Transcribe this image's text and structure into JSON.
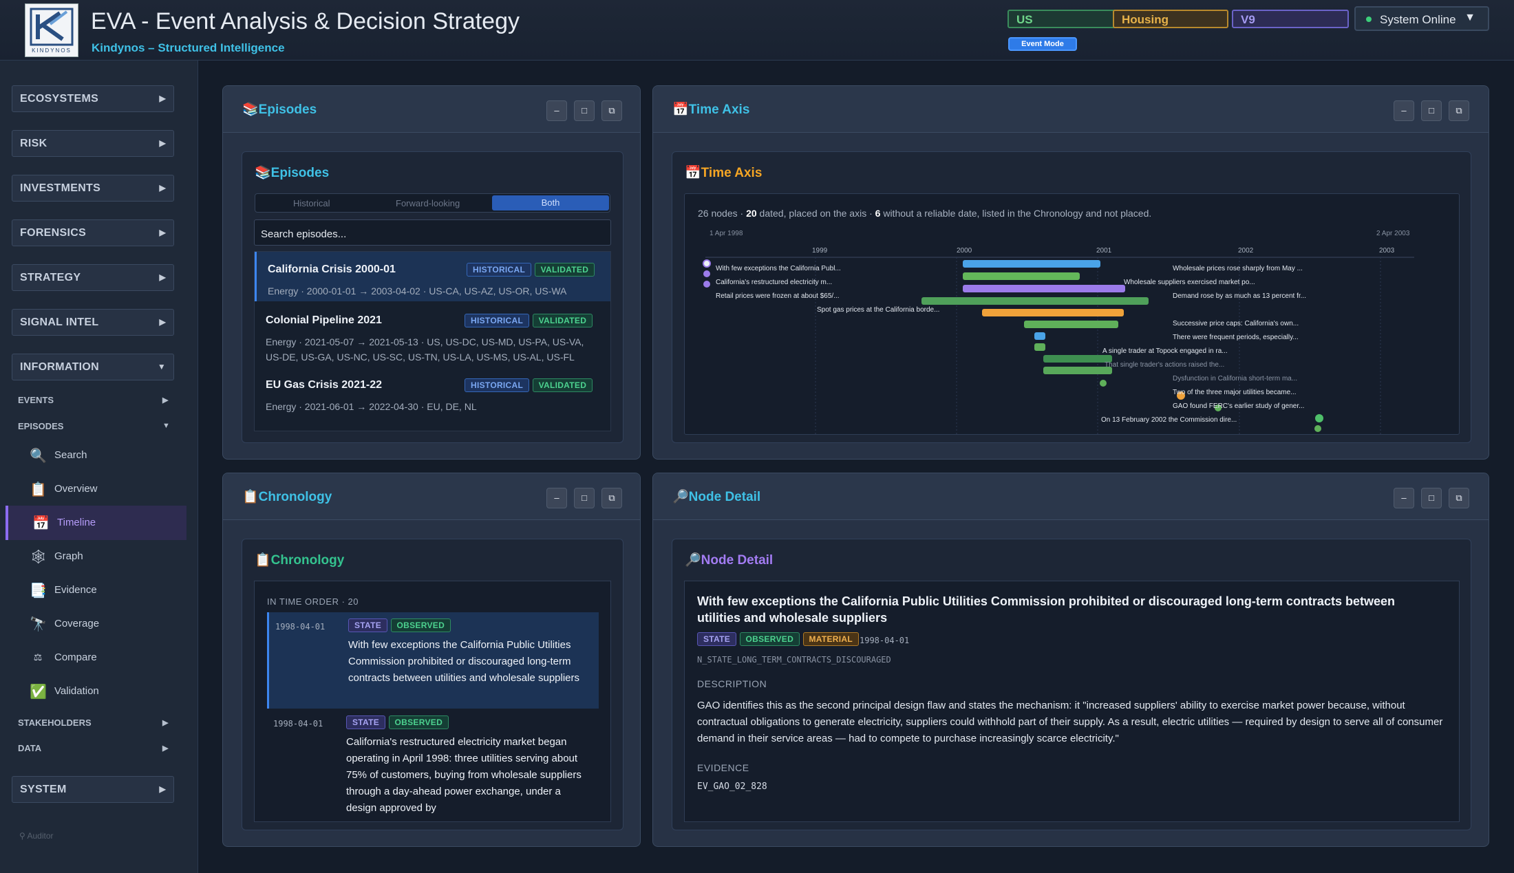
{
  "header": {
    "logo_text": "KINDYNOS",
    "title": "EVA - Event Analysis & Decision Strategy",
    "subtitle": "Kindynos – Structured Intelligence",
    "chips": [
      "US",
      "Housing",
      "V9"
    ],
    "status": "System Online",
    "mode_button": "Event Mode",
    "colors": {
      "accent": "#3fc1e6",
      "status_dot": "#3ccf7a"
    }
  },
  "sidebar": {
    "sections": [
      {
        "label": "ECOSYSTEMS"
      },
      {
        "label": "RISK"
      },
      {
        "label": "INVESTMENTS"
      },
      {
        "label": "FORENSICS"
      },
      {
        "label": "STRATEGY"
      },
      {
        "label": "SIGNAL INTEL"
      },
      {
        "label": "INFORMATION"
      }
    ],
    "info_items": [
      "EVENTS",
      "EPISODES"
    ],
    "episode_items": [
      {
        "label": "Search",
        "icon": "magnifier-icon"
      },
      {
        "label": "Overview",
        "icon": "clipboard-icon"
      },
      {
        "label": "Timeline",
        "icon": "calendar-icon"
      },
      {
        "label": "Graph",
        "icon": "network-icon"
      },
      {
        "label": "Evidence",
        "icon": "document-icon"
      },
      {
        "label": "Coverage",
        "icon": "telescope-icon"
      },
      {
        "label": "Compare",
        "icon": "scale-icon"
      },
      {
        "label": "Validation",
        "icon": "checkmark-icon"
      }
    ],
    "more_items": [
      "STAKEHOLDERS",
      "DATA"
    ],
    "system": "SYSTEM",
    "footer": "Auditor"
  },
  "episodes_panel": {
    "title": "Episodes",
    "inner_title": "Episodes",
    "tabs": [
      "Historical",
      "Forward-looking",
      "Both"
    ],
    "search_placeholder": "Search episodes...",
    "items": [
      {
        "name": "California Crisis 2000-01",
        "tag1": "HISTORICAL",
        "tag2": "VALIDATED",
        "meta": "Energy · 2000-01-01 → 2003-04-02 · US-CA, US-AZ, US-OR, US-WA"
      },
      {
        "name": "Colonial Pipeline 2021",
        "tag1": "HISTORICAL",
        "tag2": "VALIDATED",
        "meta": "Energy · 2021-05-07 → 2021-05-13 · US, US-DC, US-MD, US-PA, US-VA, US-DE, US-GA, US-NC, US-SC, US-TN, US-LA, US-MS, US-AL, US-FL"
      },
      {
        "name": "EU Gas Crisis 2021-22",
        "tag1": "HISTORICAL",
        "tag2": "VALIDATED",
        "meta": "Energy · 2021-06-01 → 2022-04-30 · EU, DE, NL"
      }
    ]
  },
  "time_axis_panel": {
    "title": "Time Axis",
    "inner_title": "Time Axis",
    "summary": {
      "total": "26 nodes · ",
      "dated": "20",
      "mid": " dated, placed on the axis · ",
      "undated": "6",
      "tail": " without a reliable date, listed in the Chronology and not placed."
    },
    "axis_start": "1 Apr 1998",
    "axis_end": "2 Apr 2003",
    "year_ticks": [
      "1999",
      "2000",
      "2001",
      "2002",
      "2003"
    ],
    "labels_left": [
      "With few exceptions the California Publ...",
      "California's restructured electricity m...",
      "Retail prices were frozen at about $65/...",
      "Spot gas prices at the California borde..."
    ],
    "labels_right": [
      "Wholesale prices rose sharply from May ...",
      "Wholesale suppliers exercised market po...",
      "Demand rose by as much as 13 percent fr...",
      "Successive price caps: California's own...",
      "There were frequent periods, especially...",
      "A single trader at Topock engaged in ra...",
      "That single trader's actions raised the...",
      "Dysfunction in California short-term ma...",
      "Two of the three major utilities became...",
      "GAO found FERC's earlier study of gener...",
      "On 13 February 2002 the Commission dire..."
    ]
  },
  "chronology_panel": {
    "title": "Chronology",
    "inner_title": "Chronology",
    "header": "IN TIME ORDER · 20",
    "rows": [
      {
        "date": "1998-04-01",
        "tag1": "STATE",
        "tag2": "OBSERVED",
        "text": "With few exceptions the California Public Utilities Commission prohibited or discouraged long-term contracts between utilities and wholesale suppliers"
      },
      {
        "date": "1998-04-01",
        "tag1": "STATE",
        "tag2": "OBSERVED",
        "text": "California's restructured electricity market began operating in April 1998: three utilities serving about 75% of customers, buying from wholesale suppliers through a day-ahead power exchange, under a design approved by"
      }
    ]
  },
  "node_detail_panel": {
    "title": "Node Detail",
    "inner_title": "Node Detail",
    "heading": "With few exceptions the California Public Utilities Commission prohibited or discouraged long-term contracts between utilities and wholesale suppliers",
    "tags": [
      "STATE",
      "OBSERVED",
      "MATERIAL"
    ],
    "date": "1998-04-01",
    "node_id": "N_STATE_LONG_TERM_CONTRACTS_DISCOURAGED",
    "description_label": "DESCRIPTION",
    "description": "GAO identifies this as the second principal design flaw and states the mechanism: it \"increased suppliers' ability to exercise market power because, without contractual obligations to generate electricity, suppliers could withhold part of their supply. As a result, electric utilities — required by design to serve all of consumer demand in their service areas — had to compete to purchase increasingly scarce electricity.\"",
    "evidence_label": "EVIDENCE",
    "evidence": "EV_GAO_02_828"
  },
  "window_controls": {
    "minimize": "–",
    "maximize": "□",
    "popout": "⧉"
  }
}
